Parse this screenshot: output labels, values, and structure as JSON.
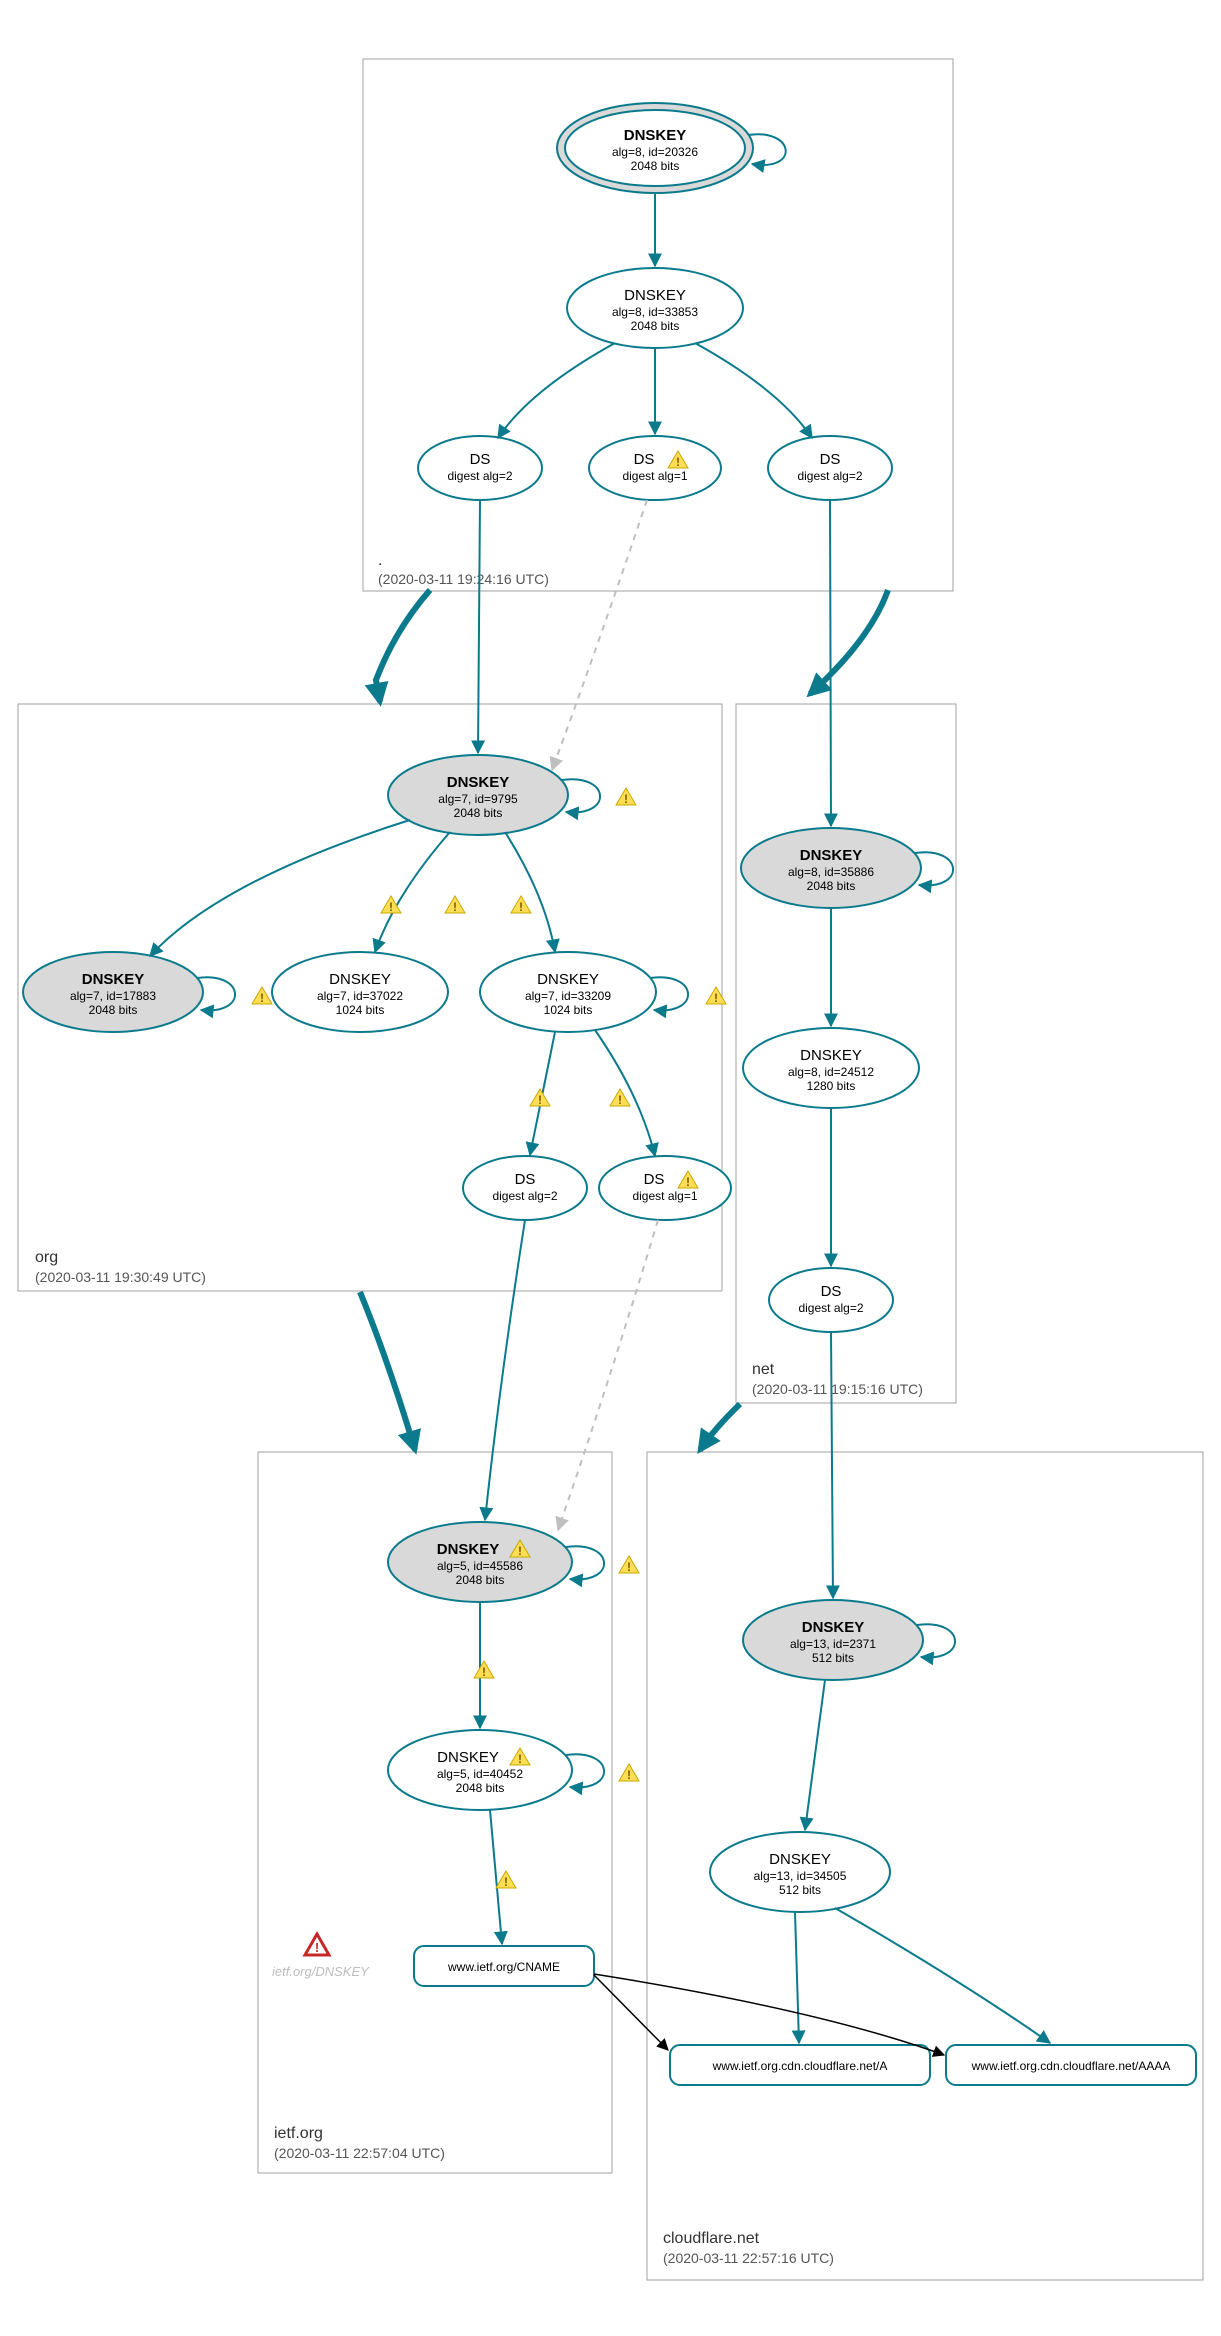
{
  "colors": {
    "teal": "#0a7a8c",
    "grey_fill": "#d8d9d8"
  },
  "zones": {
    "root": {
      "name": ".",
      "timestamp": "(2020-03-11 19:24:16 UTC)"
    },
    "org": {
      "name": "org",
      "timestamp": "(2020-03-11 19:30:49 UTC)"
    },
    "net": {
      "name": "net",
      "timestamp": "(2020-03-11 19:15:16 UTC)"
    },
    "ietf": {
      "name": "ietf.org",
      "timestamp": "(2020-03-11 22:57:04 UTC)"
    },
    "cloudflare": {
      "name": "cloudflare.net",
      "timestamp": "(2020-03-11 22:57:16 UTC)"
    }
  },
  "nodes": {
    "root_ksk": {
      "title": "DNSKEY",
      "l1": "alg=8, id=20326",
      "l2": "2048 bits"
    },
    "root_zsk": {
      "title": "DNSKEY",
      "l1": "alg=8, id=33853",
      "l2": "2048 bits"
    },
    "root_ds_a": {
      "title": "DS",
      "l1": "digest alg=2"
    },
    "root_ds_b": {
      "title": "DS",
      "l1": "digest alg=1"
    },
    "root_ds_c": {
      "title": "DS",
      "l1": "digest alg=2"
    },
    "org_ksk": {
      "title": "DNSKEY",
      "l1": "alg=7, id=9795",
      "l2": "2048 bits"
    },
    "org_k2": {
      "title": "DNSKEY",
      "l1": "alg=7, id=17883",
      "l2": "2048 bits"
    },
    "org_k3": {
      "title": "DNSKEY",
      "l1": "alg=7, id=37022",
      "l2": "1024 bits"
    },
    "org_k4": {
      "title": "DNSKEY",
      "l1": "alg=7, id=33209",
      "l2": "1024 bits"
    },
    "org_ds_a": {
      "title": "DS",
      "l1": "digest alg=2"
    },
    "org_ds_b": {
      "title": "DS",
      "l1": "digest alg=1"
    },
    "net_ksk": {
      "title": "DNSKEY",
      "l1": "alg=8, id=35886",
      "l2": "2048 bits"
    },
    "net_zsk": {
      "title": "DNSKEY",
      "l1": "alg=8, id=24512",
      "l2": "1280 bits"
    },
    "net_ds": {
      "title": "DS",
      "l1": "digest alg=2"
    },
    "ietf_ksk": {
      "title": "DNSKEY",
      "l1": "alg=5, id=45586",
      "l2": "2048 bits"
    },
    "ietf_zsk": {
      "title": "DNSKEY",
      "l1": "alg=5, id=40452",
      "l2": "2048 bits"
    },
    "ietf_cname": {
      "label": "www.ietf.org/CNAME"
    },
    "ietf_miss": {
      "label": "ietf.org/DNSKEY"
    },
    "cf_ksk": {
      "title": "DNSKEY",
      "l1": "alg=13, id=2371",
      "l2": "512 bits"
    },
    "cf_zsk": {
      "title": "DNSKEY",
      "l1": "alg=13, id=34505",
      "l2": "512 bits"
    },
    "cf_a": {
      "label": "www.ietf.org.cdn.cloudflare.net/A"
    },
    "cf_aaaa": {
      "label": "www.ietf.org.cdn.cloudflare.net/AAAA"
    }
  }
}
